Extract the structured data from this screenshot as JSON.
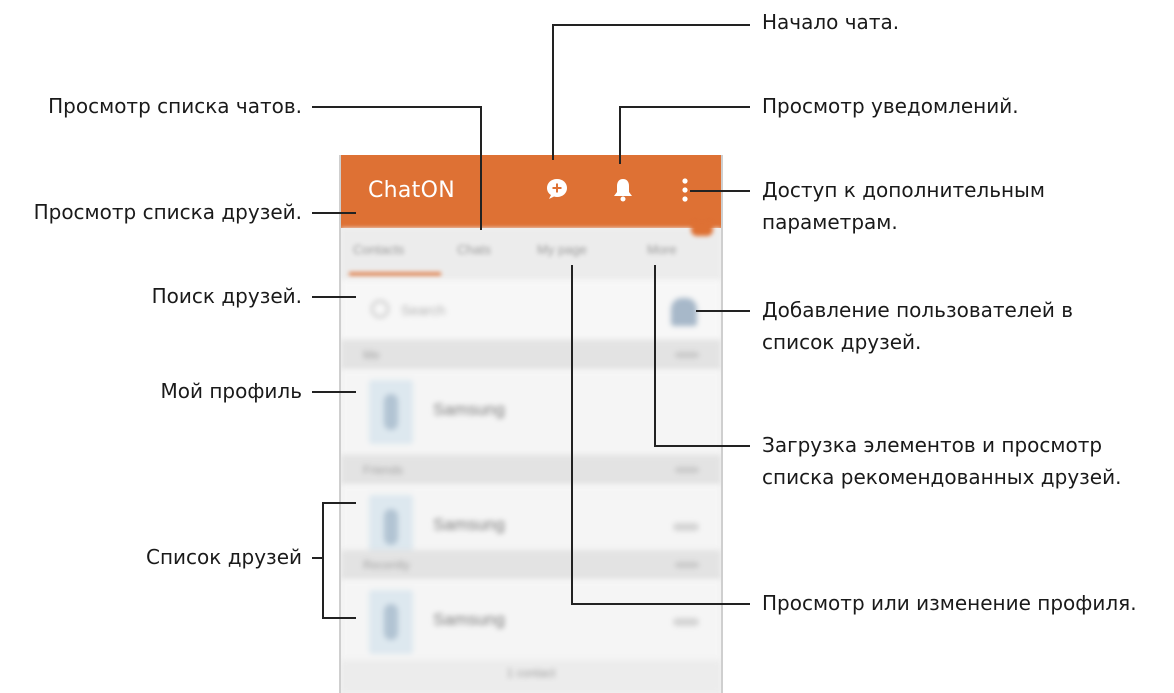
{
  "app": {
    "title": "ChatON",
    "accent_color": "#de7134",
    "actions": [
      {
        "name": "chat-plus-icon"
      },
      {
        "name": "bell-icon"
      },
      {
        "name": "overflow-menu-icon"
      }
    ]
  },
  "tabs": [
    "Contacts",
    "Chats",
    "My page",
    "More"
  ],
  "search": {
    "placeholder": "Search"
  },
  "sections": {
    "me": "Me",
    "friends": "Friends",
    "recent": "Recently"
  },
  "rows": {
    "my_profile": "Samsung",
    "friend_1": "Samsung",
    "friend_2": "Samsung"
  },
  "bottom_bar": "1 contact",
  "callouts": {
    "start_chat": "Начало чата.",
    "chat_list": "Просмотр списка чатов.",
    "notifications": "Просмотр уведомлений.",
    "more_options_1": "Доступ к дополнительным",
    "more_options_2": "параметрам.",
    "friends_list_view": "Просмотр списка друзей.",
    "search_friends": "Поиск друзей.",
    "add_users_1": "Добавление пользователей в",
    "add_users_2": "список друзей.",
    "my_profile": "Мой профиль",
    "download_1": "Загрузка элементов и просмотр",
    "download_2": "списка рекомендованных друзей.",
    "friends_list": "Список друзей",
    "profile_edit": "Просмотр или изменение профиля."
  }
}
